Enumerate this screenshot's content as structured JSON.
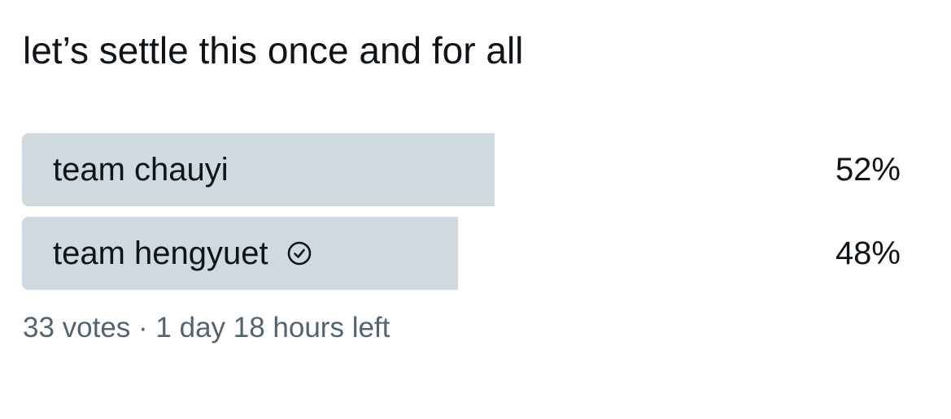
{
  "tweet": {
    "text": "let’s settle this once and for all"
  },
  "poll": {
    "options": [
      {
        "label": "team chauyi",
        "percent_text": "52%",
        "share": 0.52,
        "selected": false
      },
      {
        "label": "team hengyuet",
        "percent_text": "48%",
        "share": 0.48,
        "selected": true,
        "icon": "check-circle-icon"
      }
    ],
    "meta": "33 votes · 1 day 18 hours left"
  },
  "colors": {
    "bar": "#cfd9de",
    "text": "#0f1419",
    "meta_text": "#536471"
  }
}
